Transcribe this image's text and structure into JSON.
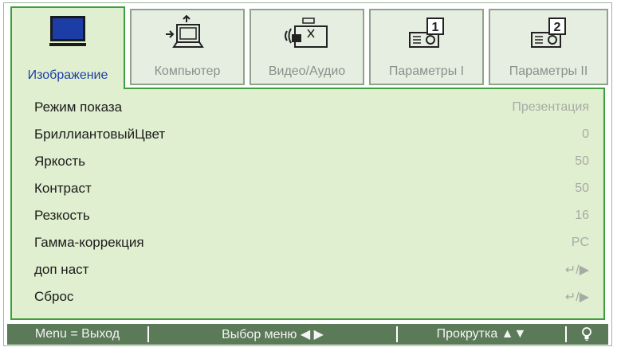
{
  "tabs": [
    {
      "label": "Изображение",
      "icon": "display-icon",
      "active": true
    },
    {
      "label": "Компьютер",
      "icon": "computer-icon",
      "active": false
    },
    {
      "label": "Видео/Аудио",
      "icon": "video-audio-icon",
      "active": false
    },
    {
      "label": "Параметры I",
      "icon": "settings-1-icon",
      "active": false
    },
    {
      "label": "Параметры II",
      "icon": "settings-2-icon",
      "active": false
    }
  ],
  "settings": [
    {
      "name": "Режим показа",
      "value": "Презентация"
    },
    {
      "name": "БриллиантовыйЦвет",
      "value": "0"
    },
    {
      "name": "Яркость",
      "value": "50"
    },
    {
      "name": "Контраст",
      "value": "50"
    },
    {
      "name": "Резкость",
      "value": "16"
    },
    {
      "name": "Гамма-коррекция",
      "value": "PC"
    },
    {
      "name": "доп наст",
      "value": "↵/▶"
    },
    {
      "name": "Сброс",
      "value": "↵/▶"
    }
  ],
  "footer": {
    "exit": "Menu = Выход",
    "select": "Выбор меню ◀ ▶",
    "scroll": "Прокрутка ▲▼",
    "help_icon": "lightbulb-icon"
  },
  "colors": {
    "active_border": "#3d9f3d",
    "panel_bg": "#e0efcf",
    "footer_bg": "#5b7a58",
    "active_label": "#1d3fa8"
  }
}
